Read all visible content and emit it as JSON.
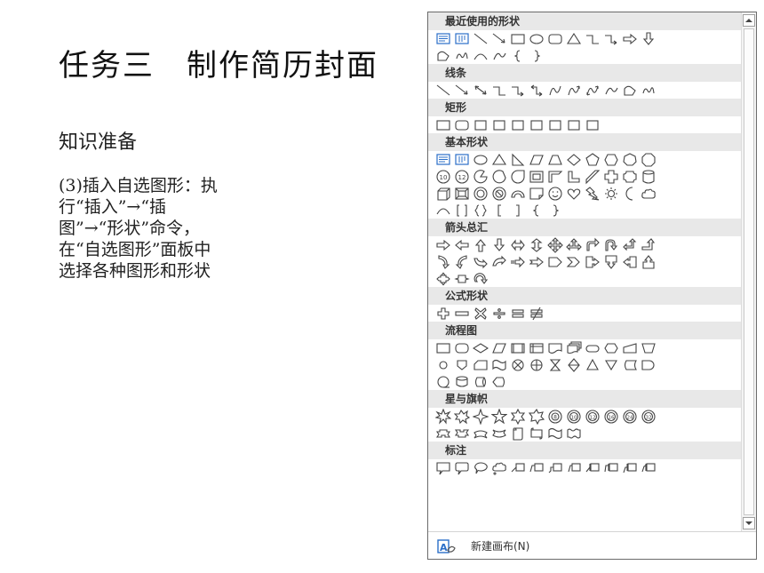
{
  "slide": {
    "title": "任务三　制作简历封面",
    "subheading": "知识准备",
    "body_lines": [
      "(3)插入自选图形：执",
      "行“插入”→“插",
      "图”→“形状”命令，",
      "在“自选图形”面板中",
      "选择各种图形和形状"
    ]
  },
  "shapes_panel": {
    "sections": [
      {
        "title": "最近使用的形状",
        "rows": [
          [
            "textbox",
            "vtextbox",
            "line",
            "arrow-line",
            "rect",
            "oval",
            "rounded-rect",
            "triangle",
            "elbow",
            "elbow-arrow",
            "right-arrow",
            "down-arrow"
          ],
          [
            "freeform",
            "scribble",
            "arc",
            "arc2",
            "left-brace",
            "right-brace"
          ]
        ]
      },
      {
        "title": "线条",
        "rows": [
          [
            "line",
            "arrow-line",
            "double-arrow-line",
            "elbow",
            "elbow-arrow",
            "elbow-double",
            "curve",
            "curve-arrow",
            "curve-double",
            "arc2",
            "freeform",
            "scribble"
          ]
        ]
      },
      {
        "title": "矩形",
        "rows": [
          [
            "rect",
            "rounded-rect",
            "snip1",
            "snip2",
            "snip-diag",
            "round-snip",
            "round1",
            "round2",
            "round-diag"
          ]
        ]
      },
      {
        "title": "基本形状",
        "rows": [
          [
            "textbox",
            "vtextbox",
            "oval",
            "triangle",
            "right-triangle",
            "parallelogram",
            "trapezoid",
            "diamond",
            "pentagon",
            "hexagon",
            "heptagon",
            "octagon"
          ],
          [
            "decagon",
            "dodecagon",
            "pie",
            "chord",
            "teardrop",
            "frame",
            "half-frame",
            "l-shape",
            "diag-stripe",
            "cross",
            "plaque",
            "can"
          ],
          [
            "cube",
            "bevel",
            "donut",
            "no-symbol",
            "block-arc",
            "folded",
            "smiley",
            "heart",
            "lightning",
            "sun",
            "moon",
            "cloud"
          ],
          [
            "arc",
            "double-bracket",
            "double-brace",
            "left-bracket",
            "right-bracket",
            "left-brace",
            "right-brace"
          ]
        ]
      },
      {
        "title": "箭头总汇",
        "rows": [
          [
            "right-arrow",
            "left-arrow",
            "up-arrow",
            "down-arrow",
            "left-right-arrow",
            "up-down-arrow",
            "quad-arrow",
            "left-right-up-arrow",
            "bent-arrow",
            "u-turn-arrow",
            "left-up-arrow",
            "bent-up-arrow"
          ],
          [
            "curved-right",
            "curved-left",
            "curved-up",
            "curved-down",
            "striped-right",
            "notched-right",
            "pentagon-arrow",
            "chevron",
            "callout-right",
            "callout-down",
            "callout-left",
            "callout-up"
          ],
          [
            "callout-quad",
            "callout-left-right",
            "circular-arrow"
          ]
        ]
      },
      {
        "title": "公式形状",
        "rows": [
          [
            "plus",
            "minus",
            "multiply",
            "divide",
            "equal",
            "not-equal"
          ]
        ]
      },
      {
        "title": "流程图",
        "rows": [
          [
            "process",
            "alt-process",
            "decision",
            "data",
            "predefined",
            "internal-storage",
            "document",
            "multidocument",
            "terminator",
            "preparation",
            "manual-input",
            "manual-operation"
          ],
          [
            "connector",
            "offpage",
            "card",
            "punched-tape",
            "summing-junction",
            "or",
            "collate",
            "sort",
            "extract",
            "merge",
            "stored-data",
            "delay"
          ],
          [
            "sequential",
            "magnetic-disk",
            "direct-access",
            "display"
          ]
        ]
      },
      {
        "title": "星与旗帜",
        "rows": [
          [
            "explosion1",
            "explosion2",
            "star4",
            "star5",
            "star6",
            "star7",
            "star8",
            "star10",
            "star12",
            "star16",
            "star24",
            "star32"
          ],
          [
            "ribbon-up",
            "ribbon-down",
            "curved-ribbon-up",
            "curved-ribbon-down",
            "vertical-scroll",
            "horizontal-scroll",
            "wave",
            "double-wave"
          ]
        ]
      },
      {
        "title": "标注",
        "rows": [
          [
            "rect-callout",
            "rounded-callout",
            "oval-callout",
            "cloud-callout",
            "line-callout1",
            "line-callout2",
            "line-callout3",
            "line-callout4",
            "accent-callout1",
            "accent-callout2",
            "accent-callout3",
            "accent-callout4"
          ]
        ]
      }
    ],
    "footer": {
      "icon": "new-canvas-icon",
      "label": "新建画布(N)"
    },
    "scroll_up_icon": "scroll-up-arrow-icon",
    "scroll_down_icon": "scroll-down-arrow-icon"
  }
}
